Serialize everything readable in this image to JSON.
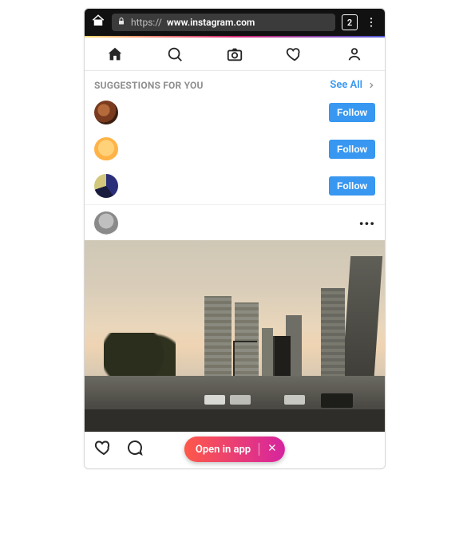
{
  "browser": {
    "url_proto": "https://",
    "url_host": "www.instagram.com",
    "tab_count": "2"
  },
  "nav": {
    "items": [
      "home",
      "search",
      "camera",
      "activity",
      "profile"
    ]
  },
  "suggestions": {
    "title": "SUGGESTIONS FOR YOU",
    "see_all": "See All",
    "items": [
      {
        "follow": "Follow"
      },
      {
        "follow": "Follow"
      },
      {
        "follow": "Follow"
      }
    ]
  },
  "post": {
    "more": "•••"
  },
  "banner": {
    "label": "Open in app"
  }
}
